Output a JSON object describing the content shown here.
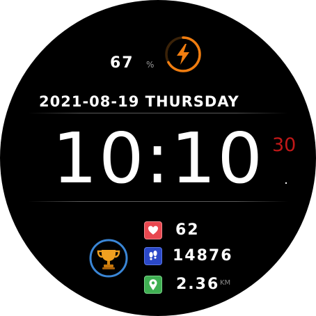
{
  "battery": {
    "value": "67",
    "unit": "%",
    "level": 0.67
  },
  "date": {
    "text": "2021-08-19 THURSDAY"
  },
  "time": {
    "hours_minutes": "10:10",
    "seconds": "30"
  },
  "stats": {
    "heart_rate": {
      "value": "62",
      "icon": "heart-icon"
    },
    "steps": {
      "value": "14876",
      "icon": "footsteps-icon"
    },
    "distance": {
      "value": "2.36",
      "unit": "KM",
      "icon": "location-pin-icon"
    }
  },
  "colors": {
    "battery_accent": "#f07d10",
    "trophy_ring": "#3a86d6",
    "seconds": "#c01818",
    "heart_bg": "#e8474f",
    "steps_bg": "#2b48c8",
    "distance_bg": "#3faf52"
  }
}
